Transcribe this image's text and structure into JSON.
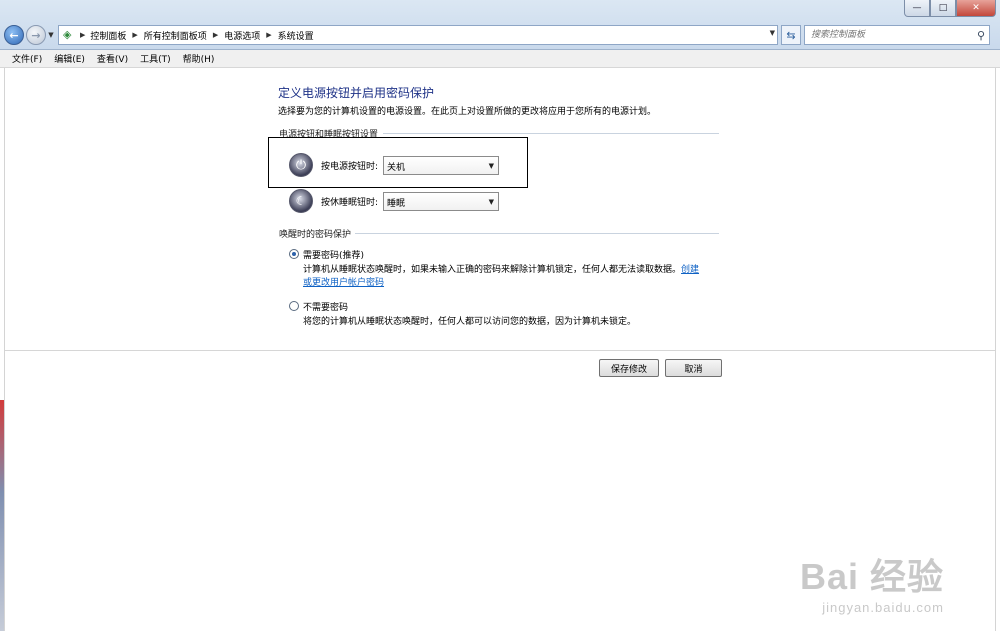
{
  "window": {
    "minimize": "—",
    "maximize": "□",
    "close": "✕"
  },
  "nav": {
    "back": "←",
    "forward": "→",
    "refresh": "⇆"
  },
  "address": {
    "breadcrumbs": [
      "控制面板",
      "所有控制面板项",
      "电源选项",
      "系统设置"
    ]
  },
  "search": {
    "placeholder": "搜索控制面板"
  },
  "menu": [
    "文件(F)",
    "编辑(E)",
    "查看(V)",
    "工具(T)",
    "帮助(H)"
  ],
  "page": {
    "title": "定义电源按钮并启用密码保护",
    "description": "选择要为您的计算机设置的电源设置。在此页上对设置所做的更改将应用于您所有的电源计划。"
  },
  "buttons_section": {
    "header": "电源按钮和睡眠按钮设置",
    "power_label": "按电源按钮时:",
    "power_value": "关机",
    "sleep_label": "按休睡眠钮时:",
    "sleep_value": "睡眠"
  },
  "password_section": {
    "header": "唤醒时的密码保护",
    "option1_label": "需要密码(推荐)",
    "option1_desc": "计算机从睡眠状态唤醒时，如果未输入正确的密码来解除计算机锁定，任何人都无法读取数据。",
    "option1_link": "创建或更改用户帐户密码",
    "option2_label": "不需要密码",
    "option2_desc": "将您的计算机从睡眠状态唤醒时，任何人都可以访问您的数据，因为计算机未锁定。",
    "selected": "option1"
  },
  "actions": {
    "save": "保存修改",
    "cancel": "取消"
  },
  "watermark": {
    "main": "Bai 经验",
    "sub": "jingyan.baidu.com"
  }
}
